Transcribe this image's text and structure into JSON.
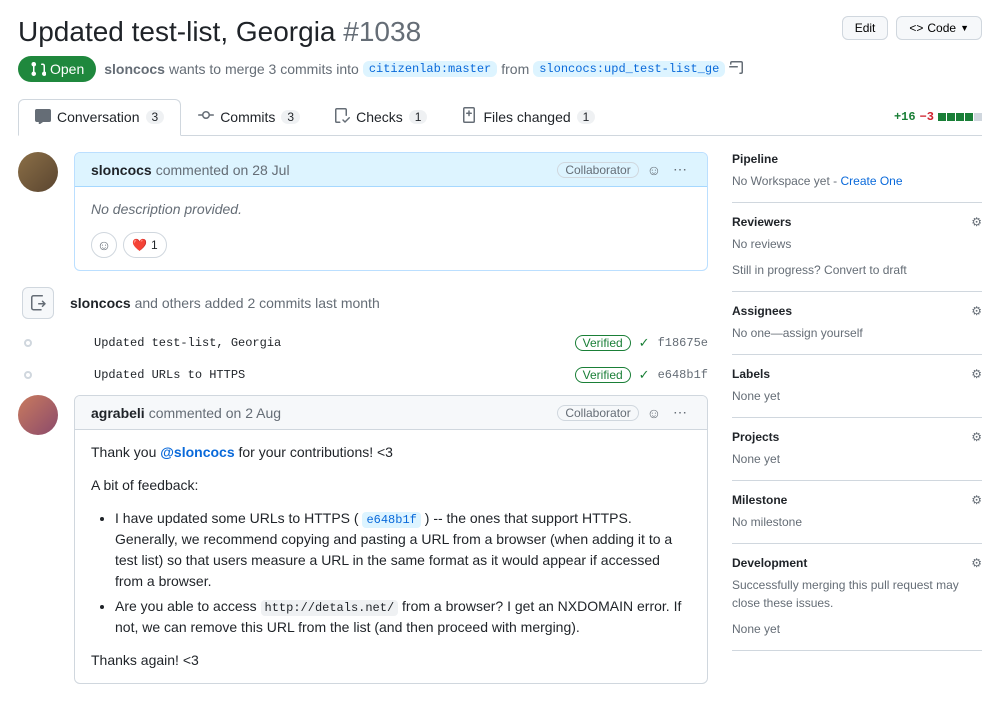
{
  "header": {
    "title": "Updated test-list, Georgia",
    "issue_number": "#1038",
    "edit_label": "Edit",
    "code_label": "Code"
  },
  "state": {
    "label": "Open",
    "actor": "sloncocs",
    "merge_text": "wants to merge 3 commits into",
    "base_branch": "citizenlab:master",
    "from_text": "from",
    "head_branch": "sloncocs:upd_test-list_ge"
  },
  "tabs": {
    "conversation": {
      "label": "Conversation",
      "count": "3"
    },
    "commits": {
      "label": "Commits",
      "count": "3"
    },
    "checks": {
      "label": "Checks",
      "count": "1"
    },
    "files": {
      "label": "Files changed",
      "count": "1"
    },
    "additions": "+16",
    "deletions": "−3"
  },
  "comment1": {
    "author": "sloncocs",
    "action": "commented",
    "when": "on 28 Jul",
    "role": "Collaborator",
    "body_placeholder": "No description provided.",
    "heart_count": "1"
  },
  "push_event": {
    "actor": "sloncocs",
    "rest": "and others added 2 commits last month"
  },
  "commits_list": [
    {
      "msg": "Updated test-list, Georgia",
      "verified": "Verified",
      "sha": "f18675e"
    },
    {
      "msg": "Updated URLs to HTTPS",
      "verified": "Verified",
      "sha": "e648b1f"
    }
  ],
  "comment2": {
    "author": "agrabeli",
    "action": "commented",
    "when": "on 2 Aug",
    "role": "Collaborator",
    "p1_pre": "Thank you ",
    "p1_mention": "@sloncocs",
    "p1_post": " for your contributions! <3",
    "p2": "A bit of feedback:",
    "li1_pre": "I have updated some URLs to HTTPS ( ",
    "li1_sha": "e648b1f",
    "li1_post": " ) -- the ones that support HTTPS. Generally, we recommend copying and pasting a URL from a browser (when adding it to a test list) so that users measure a URL in the same format as it would appear if accessed from a browser.",
    "li2_pre": "Are you able to access ",
    "li2_code": "http://detals.net/",
    "li2_post": " from a browser? I get an NXDOMAIN error. If not, we can remove this URL from the list (and then proceed with merging).",
    "p3": "Thanks again! <3"
  },
  "sidebar": {
    "pipeline_title": "Pipeline",
    "pipeline_text": "No Workspace yet - ",
    "pipeline_link": "Create One",
    "reviewers_title": "Reviewers",
    "reviewers_text": "No reviews",
    "reviewers_draft": "Still in progress? Convert to draft",
    "assignees_title": "Assignees",
    "assignees_text": "No one—assign yourself",
    "labels_title": "Labels",
    "labels_text": "None yet",
    "projects_title": "Projects",
    "projects_text": "None yet",
    "milestone_title": "Milestone",
    "milestone_text": "No milestone",
    "development_title": "Development",
    "development_text": "Successfully merging this pull request may close these issues.",
    "development_none": "None yet"
  }
}
